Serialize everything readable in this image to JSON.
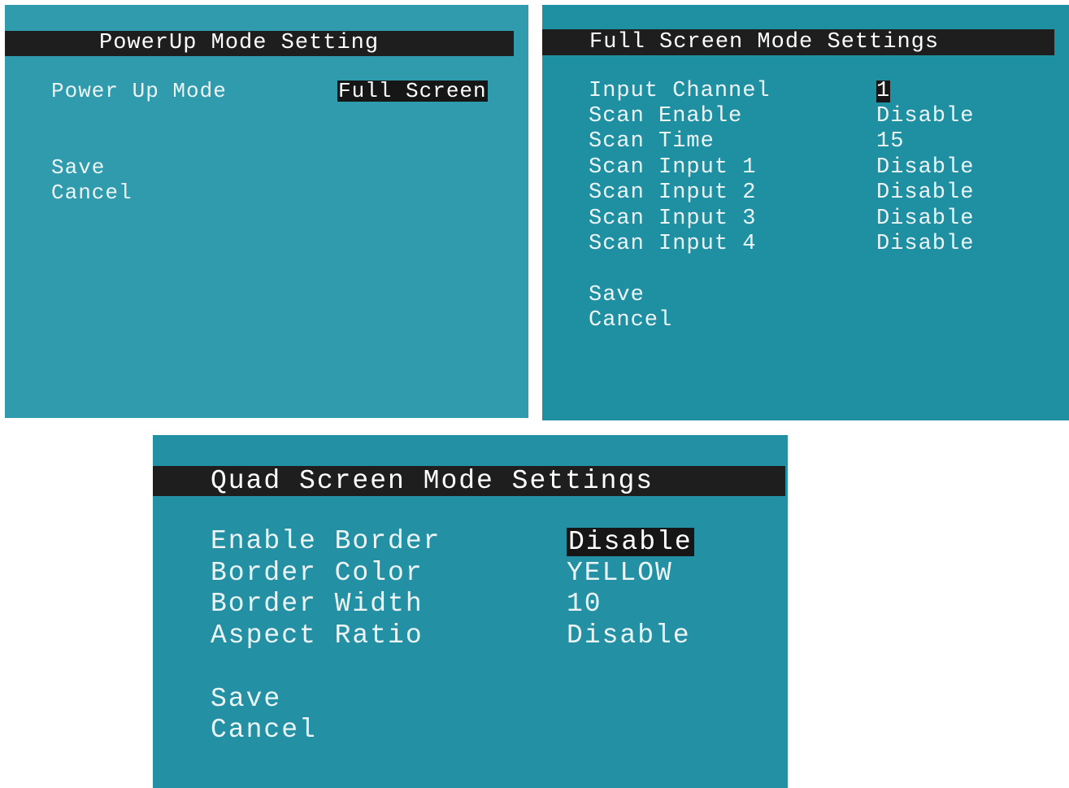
{
  "powerup_panel": {
    "title": "PowerUp Mode Setting",
    "power_up_mode_label": "Power Up Mode",
    "power_up_mode_value": "Full Screen",
    "save_label": "Save",
    "cancel_label": "Cancel"
  },
  "fullscreen_panel": {
    "title": "Full Screen Mode Settings",
    "rows": [
      {
        "label": "Input Channel",
        "value": "1"
      },
      {
        "label": "Scan Enable",
        "value": "Disable"
      },
      {
        "label": "Scan Time",
        "value": "15"
      },
      {
        "label": "Scan Input 1",
        "value": "Disable"
      },
      {
        "label": "Scan Input 2",
        "value": "Disable"
      },
      {
        "label": "Scan Input 3",
        "value": "Disable"
      },
      {
        "label": "Scan Input 4",
        "value": "Disable"
      }
    ],
    "save_label": "Save",
    "cancel_label": "Cancel"
  },
  "quad_panel": {
    "title": "Quad Screen Mode Settings",
    "rows": [
      {
        "label": "Enable Border",
        "value": "Disable"
      },
      {
        "label": "Border Color",
        "value": "YELLOW"
      },
      {
        "label": "Border Width",
        "value": "10"
      },
      {
        "label": "Aspect Ratio",
        "value": "Disable"
      }
    ],
    "save_label": "Save",
    "cancel_label": "Cancel"
  },
  "colors": {
    "powerup_bg": "#2f9bac",
    "fullscreen_bg": "#1f8fa2",
    "quad_bg": "#2490a3",
    "titlebar_bg": "#1e1e1e",
    "text": "#ecf4f5",
    "highlight_bg": "#161616"
  }
}
